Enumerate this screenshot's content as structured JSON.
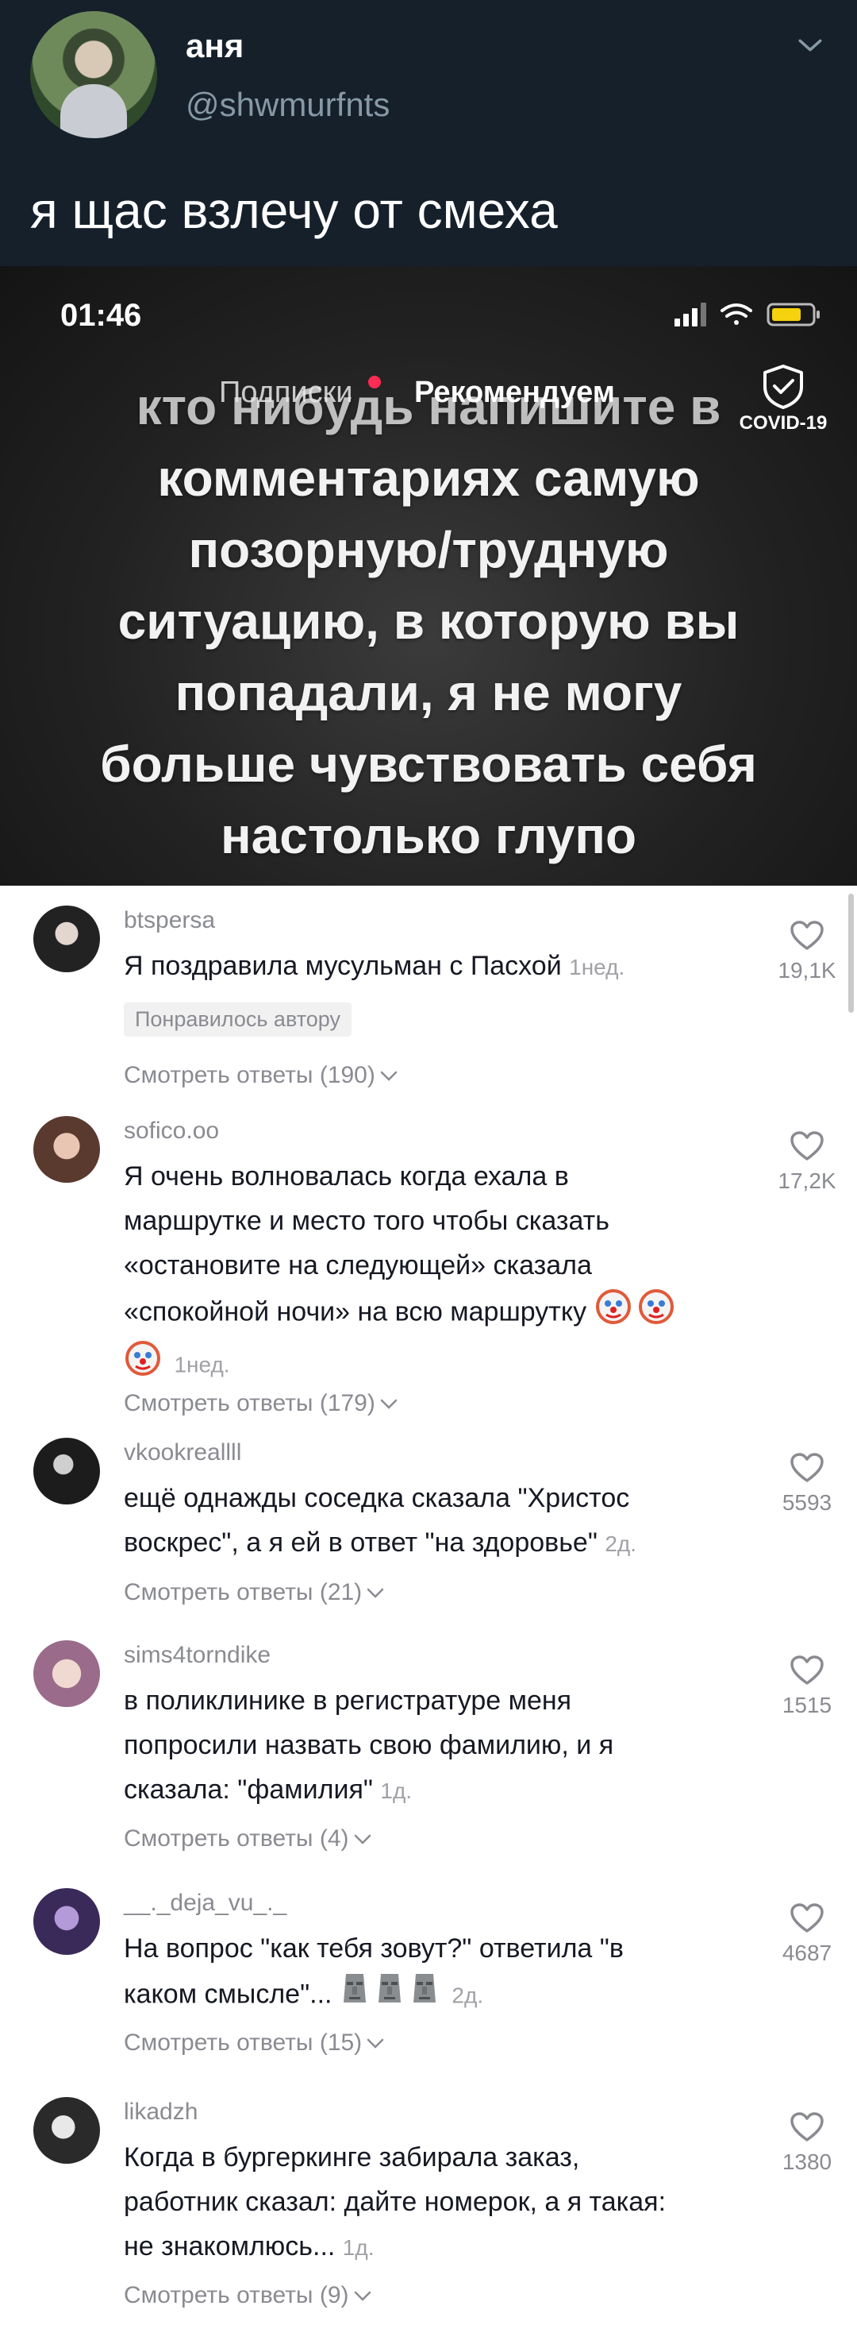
{
  "tweet": {
    "name": "аня",
    "handle": "@shwmurfnts",
    "text": "я щас взлечу от смеха"
  },
  "video": {
    "status_time": "01:46",
    "tab_following": "Подписки",
    "tab_recommended": "Рекомендуем",
    "covid_label": "COVID-19",
    "caption_lines": [
      "кто нибудь напишите в",
      "комментариях самую",
      "позорную/трудную",
      "ситуацию, в которую вы",
      "попадали, я не могу",
      "больше чувствовать себя",
      "настолько глупо"
    ]
  },
  "comments": [
    {
      "username": "btspersa",
      "text": "Я поздравила мусульман с Пасхой",
      "time": "1нед.",
      "likes": "19,1K",
      "badge": "Понравилось автору",
      "replies": "Смотреть ответы (190)"
    },
    {
      "username": "sofico.oo",
      "text_lines": [
        "Я очень волновалась когда ехала в",
        "маршрутке и место того чтобы сказать",
        "«остановите на следующей» сказала",
        "«спокойной ночи» на всю маршрутку"
      ],
      "time": "1нед.",
      "likes": "17,2K",
      "replies": "Смотреть ответы (179)"
    },
    {
      "username": "vkookreallll",
      "text_lines": [
        "ещё однажды соседка сказала \"Христос",
        "воскрес\", а я ей в ответ \"на здоровье\""
      ],
      "time": "2д.",
      "likes": "5593",
      "replies": "Смотреть ответы (21)"
    },
    {
      "username": "sims4torndike",
      "text_lines": [
        "в поликлинике в регистратуре меня",
        "попросили назвать свою фамилию, и я",
        "сказала: \"фамилия\""
      ],
      "time": "1д.",
      "likes": "1515",
      "replies": "Смотреть ответы (4)"
    },
    {
      "username": "__._deja_vu_._",
      "text_lines": [
        "На вопрос \"как тебя зовут?\" ответила \"в",
        "каком смысле\"..."
      ],
      "time": "2д.",
      "likes": "4687",
      "replies": "Смотреть ответы (15)"
    },
    {
      "username": "likadzh",
      "text_lines": [
        "Когда в бургеркинге забирала заказ,",
        "работник сказал: дайте номерок, а я такая:",
        "не знакомлюсь..."
      ],
      "time": "1д.",
      "likes": "1380",
      "replies": "Смотреть ответы (9)"
    }
  ],
  "colors": {
    "twitter_bg": "#15202b",
    "twitter_secondary": "#8899a6",
    "tiktok_dot": "#ff2b54",
    "comment_text": "#161823",
    "comment_secondary": "#8a8b91"
  }
}
